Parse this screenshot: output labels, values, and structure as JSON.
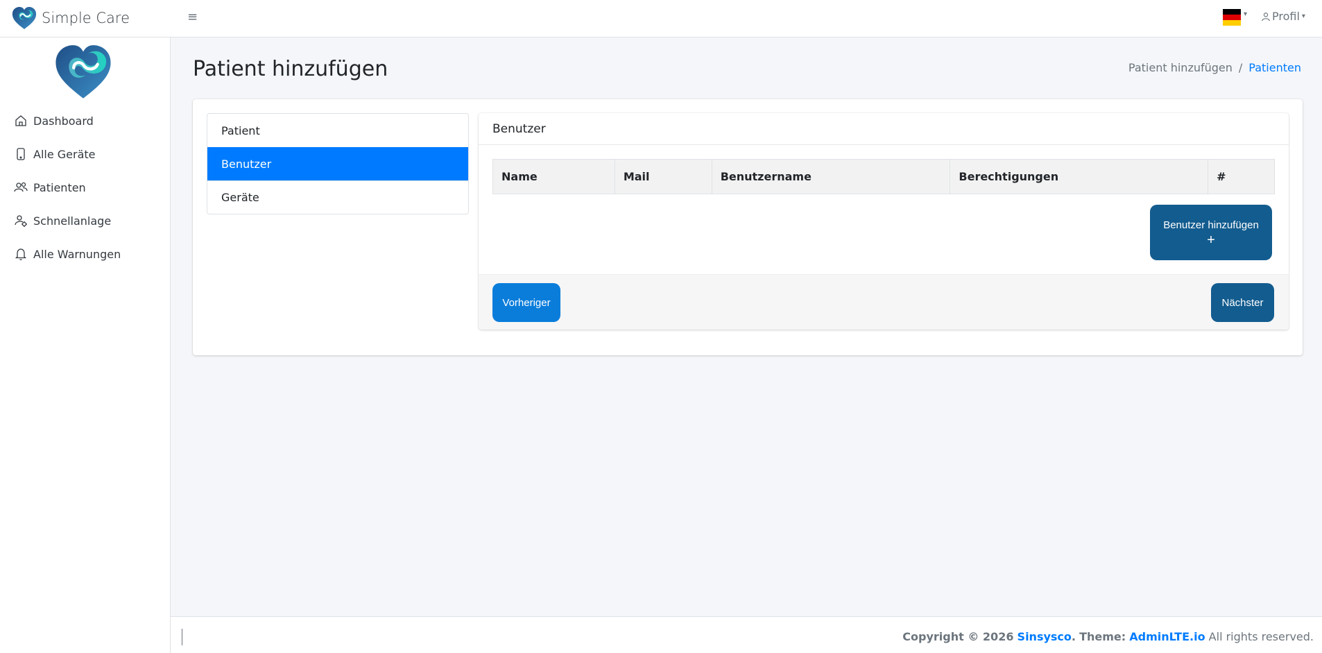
{
  "app": {
    "brand_name": "Simple Care",
    "menu_icon": "hamburger-icon",
    "language_flag": "germany-flag",
    "profile_label": "Profil"
  },
  "sidebar": {
    "items": [
      {
        "label": "Dashboard",
        "icon": "home-icon"
      },
      {
        "label": "Alle Geräte",
        "icon": "tablet-icon"
      },
      {
        "label": "Patienten",
        "icon": "users-icon"
      },
      {
        "label": "Schnellanlage",
        "icon": "user-gear-icon"
      },
      {
        "label": "Alle Warnungen",
        "icon": "bell-icon"
      }
    ]
  },
  "page": {
    "title": "Patient hinzufügen",
    "breadcrumb": {
      "current": "Patient hinzufügen",
      "separator": "/",
      "link": "Patienten"
    }
  },
  "steps": {
    "items": [
      {
        "label": "Patient"
      },
      {
        "label": "Benutzer"
      },
      {
        "label": "Geräte"
      }
    ],
    "active_label": "Benutzer"
  },
  "panel": {
    "title": "Benutzer",
    "table_headers": [
      "Name",
      "Mail",
      "Benutzername",
      "Berechtigungen",
      "#"
    ],
    "add_button_label": "Benutzer hinzufügen",
    "add_button_symbol": "+",
    "prev_label": "Vorheriger",
    "next_label": "Nächster"
  },
  "footer": {
    "copyright": "Copyright © 2026",
    "company": "Sinsysco",
    "theme_label": "Theme:",
    "theme": "AdminLTE.io",
    "rights": "All rights reserved."
  },
  "colors": {
    "active": "#007bff",
    "primary_dark": "#135c8f",
    "primary_btn": "#0a7ddb",
    "flag": [
      "#000000",
      "#dd0000",
      "#ffce00"
    ]
  }
}
